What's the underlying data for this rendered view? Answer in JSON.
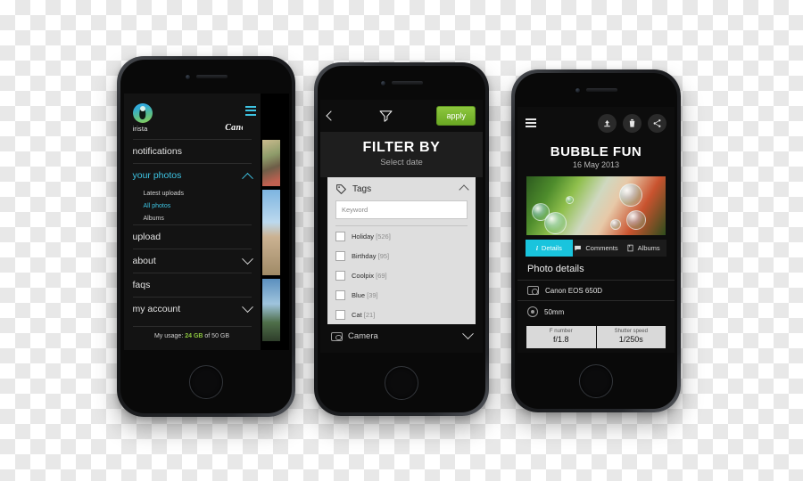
{
  "phone1": {
    "brand_logo": "irista-logo-icon",
    "logo_word": "irista",
    "canon": "Canon",
    "menu": [
      {
        "label": "notifications",
        "state": "plain"
      },
      {
        "label": "your photos",
        "state": "active-expanded",
        "children": [
          {
            "label": "Latest uploads",
            "selected": false
          },
          {
            "label": "All photos",
            "selected": true
          },
          {
            "label": "Albums",
            "selected": false
          }
        ]
      },
      {
        "label": "upload",
        "state": "plain"
      },
      {
        "label": "about",
        "state": "collapsed"
      },
      {
        "label": "faqs",
        "state": "plain"
      },
      {
        "label": "my account",
        "state": "collapsed"
      }
    ],
    "usage_prefix": "My usage: ",
    "usage_value": "24 GB",
    "usage_suffix": " of 50 GB"
  },
  "phone2": {
    "back_icon": "back-chevron-icon",
    "filter_icon": "funnel-icon",
    "apply_label": "apply",
    "title": "FILTER BY",
    "subtitle": "Select date",
    "tags_section": {
      "icon": "tag-icon",
      "label": "Tags",
      "keyword_placeholder": "Keyword",
      "keyword_value": "",
      "options": [
        {
          "label": "Holiday",
          "count": "[526]",
          "checked": false
        },
        {
          "label": "Birthday",
          "count": "[95]",
          "checked": false
        },
        {
          "label": "Coolpix",
          "count": "[69]",
          "checked": false
        },
        {
          "label": "Blue",
          "count": "[39]",
          "checked": false
        },
        {
          "label": "Cat",
          "count": "[21]",
          "checked": false
        }
      ]
    },
    "camera_section": {
      "icon": "camera-icon",
      "label": "Camera"
    }
  },
  "phone3": {
    "menu_icon": "hamburger-icon",
    "actions": [
      {
        "name": "download-icon"
      },
      {
        "name": "trash-icon"
      },
      {
        "name": "share-icon"
      }
    ],
    "title": "BUBBLE FUN",
    "date": "16 May 2013",
    "photo_alt": "child-blowing-bubbles-photo",
    "tabs": [
      {
        "label": "Details",
        "icon": "info-icon",
        "active": true
      },
      {
        "label": "Comments",
        "icon": "comment-icon",
        "active": false
      },
      {
        "label": "Albums",
        "icon": "album-icon",
        "active": false
      }
    ],
    "section_title": "Photo details",
    "rows": [
      {
        "icon": "camera-body-icon",
        "text": "Canon EOS 650D"
      },
      {
        "icon": "lens-icon",
        "text": "50mm"
      }
    ],
    "exif": [
      {
        "key": "F number",
        "value": "f/1.8"
      },
      {
        "key": "Shutter speed",
        "value": "1/250s"
      }
    ]
  },
  "colors": {
    "accent_cyan": "#3ec4e3",
    "tab_cyan": "#19c4dd",
    "apply_green": "#8ec73f",
    "usage_green": "#8cc63f"
  }
}
